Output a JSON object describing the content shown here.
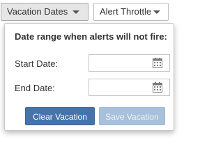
{
  "tabs": {
    "vacation_label": "Vacation Dates",
    "throttle_label": "Alert Throttle"
  },
  "vacation_panel": {
    "heading": "Date range when alerts will not fire:",
    "start_label": "Start Date:",
    "start_value": "",
    "end_label": "End Date:",
    "end_value": "",
    "clear_button": "Clear Vacation",
    "save_button": "Save Vacation",
    "save_enabled": false
  },
  "colors": {
    "primary_button": "#4474aa",
    "disabled_button": "#a7c0dc",
    "active_tab_bg": "#e6e6e6"
  },
  "icons": [
    "chevron-down-icon",
    "calendar-icon"
  ]
}
